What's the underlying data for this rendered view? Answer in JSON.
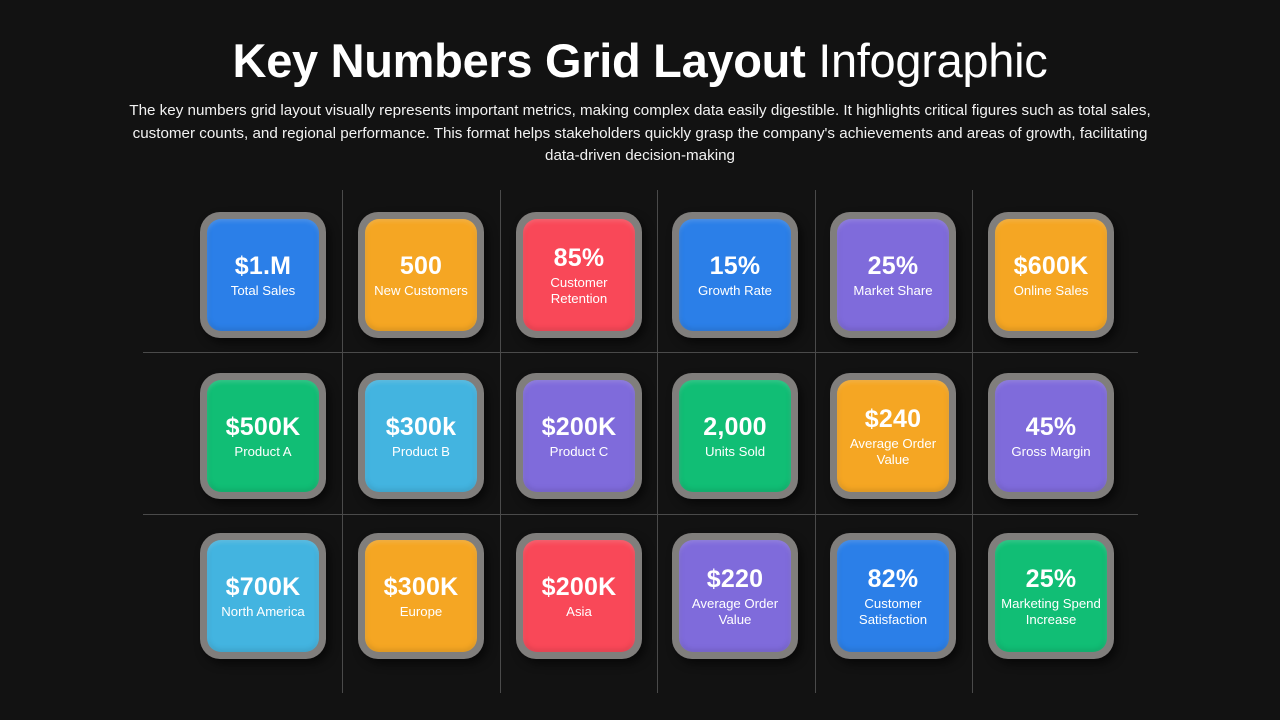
{
  "background_color": "#121212",
  "header": {
    "title_bold": "Key Numbers Grid Layout",
    "title_light": "Infographic",
    "subtitle": "The key numbers grid layout visually represents important metrics, making complex data easily digestible. It highlights critical figures such as total sales, customer counts, and regional performance. This format helps stakeholders quickly grasp the company's achievements and areas of growth, facilitating data-driven decision-making"
  },
  "palette": {
    "blue": "#2B7FE8",
    "amber": "#F5A623",
    "red": "#F94858",
    "purple": "#7F6BDB",
    "green": "#11BE75",
    "sky": "#43B4E0",
    "frame": "#807E7C",
    "rule": "#4A4A4A"
  },
  "grid": {
    "rows": [
      {
        "cards": [
          {
            "value": "$1.M",
            "label": "Total Sales",
            "color": "blue"
          },
          {
            "value": "500",
            "label": "New Customers",
            "color": "amber"
          },
          {
            "value": "85%",
            "label": "Customer Retention",
            "color": "red"
          },
          {
            "value": "15%",
            "label": "Growth Rate",
            "color": "blue"
          },
          {
            "value": "25%",
            "label": "Market Share",
            "color": "purple"
          },
          {
            "value": "$600K",
            "label": "Online Sales",
            "color": "amber"
          }
        ]
      },
      {
        "cards": [
          {
            "value": "$500K",
            "label": "Product A",
            "color": "green"
          },
          {
            "value": "$300k",
            "label": "Product B",
            "color": "sky"
          },
          {
            "value": "$200K",
            "label": "Product C",
            "color": "purple"
          },
          {
            "value": "2,000",
            "label": "Units Sold",
            "color": "green"
          },
          {
            "value": "$240",
            "label": "Average Order Value",
            "color": "amber"
          },
          {
            "value": "45%",
            "label": "Gross Margin",
            "color": "purple"
          }
        ]
      },
      {
        "cards": [
          {
            "value": "$700K",
            "label": "North America",
            "color": "sky"
          },
          {
            "value": "$300K",
            "label": "Europe",
            "color": "amber"
          },
          {
            "value": "$200K",
            "label": "Asia",
            "color": "red"
          },
          {
            "value": "$220",
            "label": "Average Order Value",
            "color": "purple"
          },
          {
            "value": "82%",
            "label": "Customer Satisfaction",
            "color": "blue"
          },
          {
            "value": "25%",
            "label": "Marketing Spend Increase",
            "color": "green"
          }
        ]
      }
    ]
  }
}
